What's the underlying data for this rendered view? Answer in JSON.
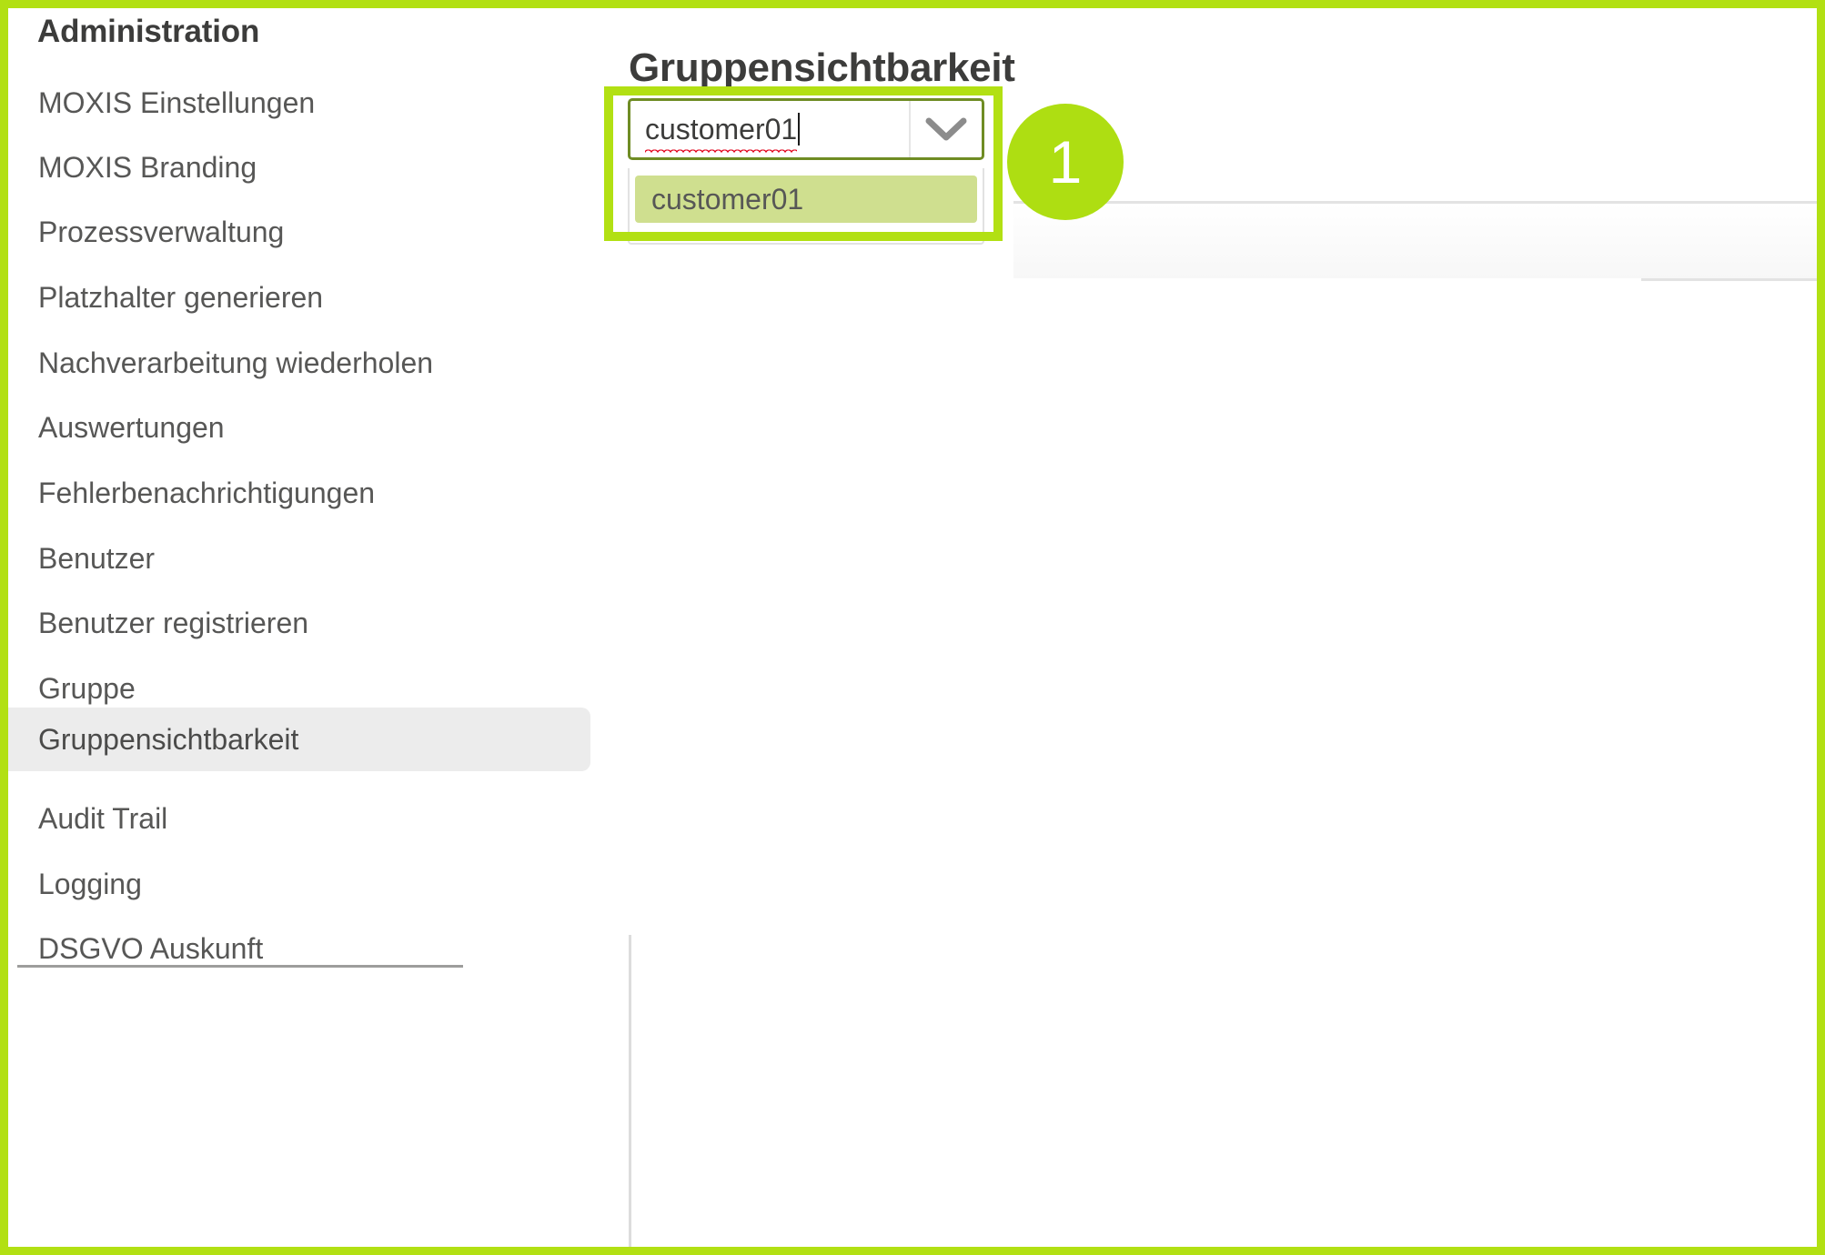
{
  "sidebar": {
    "title": "Administration",
    "items": [
      {
        "label": "MOXIS Einstellungen",
        "active": false
      },
      {
        "label": "MOXIS Branding",
        "active": false
      },
      {
        "label": "Prozessverwaltung",
        "active": false
      },
      {
        "label": "Platzhalter generieren",
        "active": false
      },
      {
        "label": "Nachverarbeitung wiederholen",
        "active": false
      },
      {
        "label": "Auswertungen",
        "active": false
      },
      {
        "label": "Fehlerbenachrichtigungen",
        "active": false
      },
      {
        "label": "Benutzer",
        "active": false
      },
      {
        "label": "Benutzer registrieren",
        "active": false
      },
      {
        "label": "Gruppe",
        "active": false
      },
      {
        "label": "Gruppensichtbarkeit",
        "active": true
      },
      {
        "label": "Audit Trail",
        "active": false
      },
      {
        "label": "Logging",
        "active": false
      },
      {
        "label": "DSGVO Auskunft",
        "active": false
      }
    ]
  },
  "main": {
    "page_title": "Gruppensichtbarkeit",
    "combobox": {
      "value": "customer01",
      "dropdown_icon": "chevron-down-icon",
      "options": [
        {
          "label": "customer01",
          "highlighted": true
        }
      ]
    }
  },
  "annotation": {
    "step_number": "1"
  },
  "colors": {
    "accent_green": "#b2e013",
    "badge_green": "#aede12",
    "option_highlight": "#cfdf8f",
    "input_border": "#6f8c24",
    "active_item_bg": "#ececec",
    "text": "#575756",
    "heading": "#3c3c3b",
    "spellcheck_red": "#e2001a"
  }
}
